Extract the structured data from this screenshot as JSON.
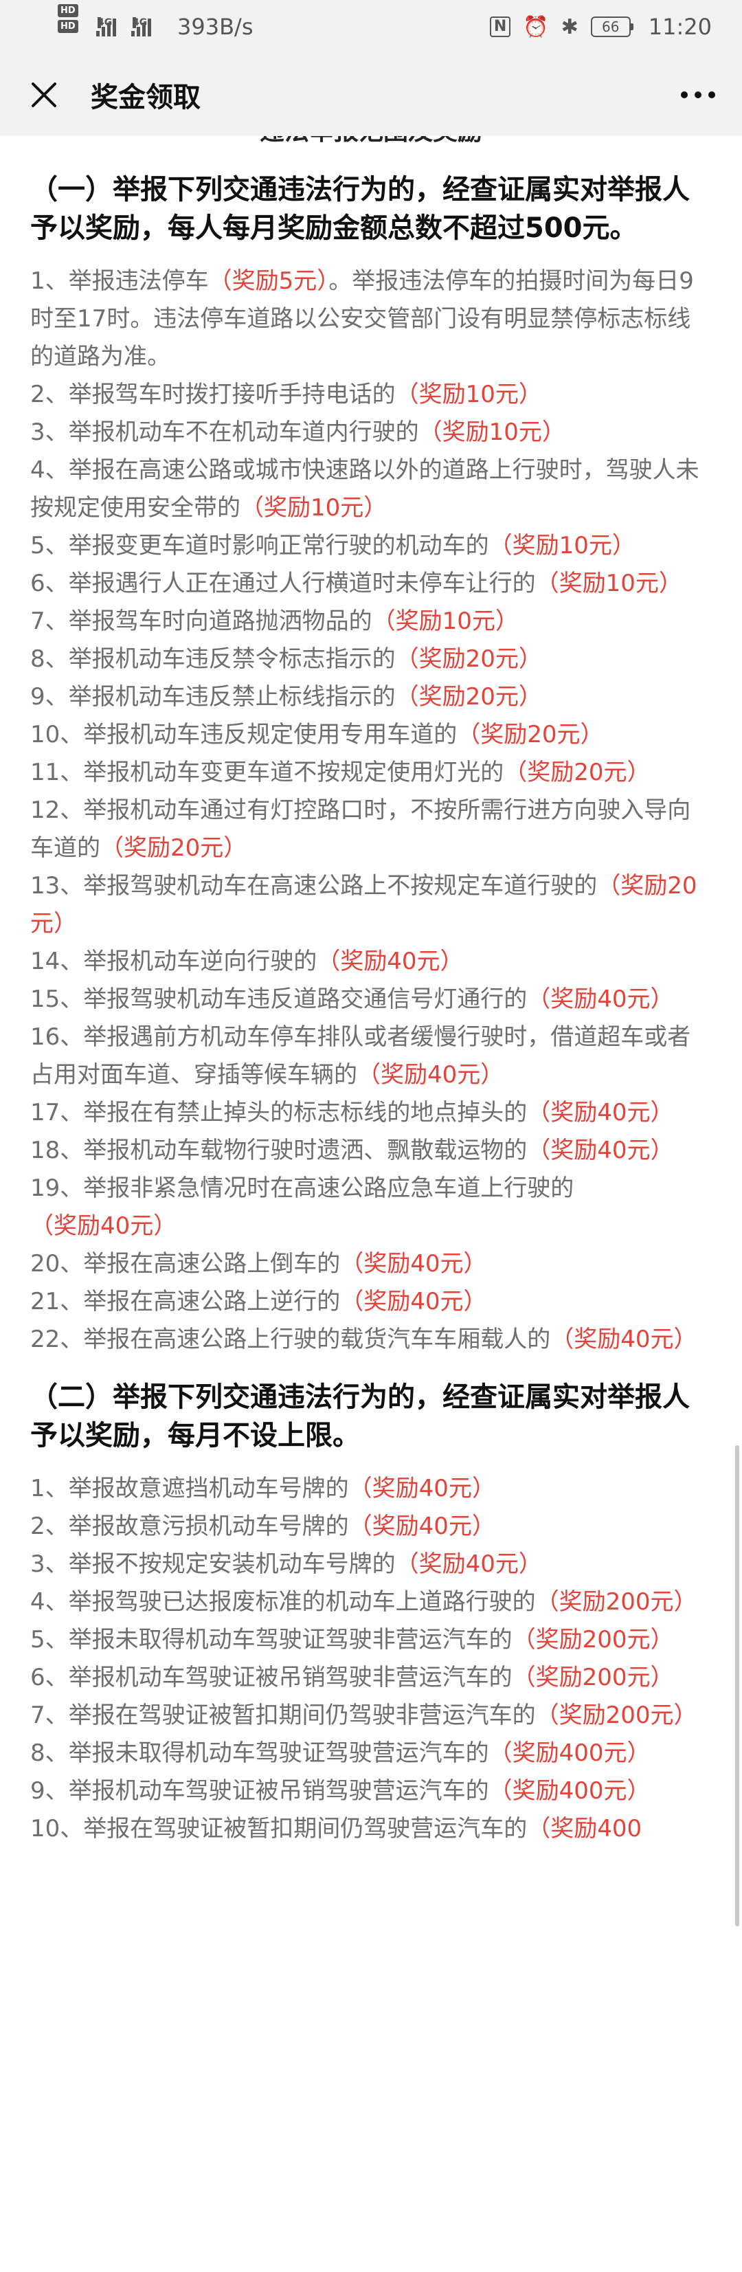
{
  "status_bar": {
    "hd1": "HD",
    "hd2": "HD",
    "sig1": "4G",
    "sig2": "4G",
    "speed": "393B/s",
    "battery": "66",
    "time": "11:20"
  },
  "nav": {
    "title": "奖金领取"
  },
  "clipped_heading": "违法举报范围及奖励",
  "section1": {
    "heading": "（一）举报下列交通违法行为的，经查证属实对举报人予以奖励，每人每月奖励金额总数不超过500元。",
    "items": [
      {
        "num": "1、",
        "text": "举报违法停车",
        "reward": "（奖励5元）",
        "after": "。举报违法停车的拍摄时间为每日9时至17时。违法停车道路以公安交管部门设有明显禁停标志标线的道路为准。"
      },
      {
        "num": "2、",
        "text": "举报驾车时拨打接听手持电话的",
        "reward": "（奖励10元）",
        "after": ""
      },
      {
        "num": "3、",
        "text": "举报机动车不在机动车道内行驶的",
        "reward": "（奖励10元）",
        "after": ""
      },
      {
        "num": "4、",
        "text": "举报在高速公路或城市快速路以外的道路上行驶时，驾驶人未按规定使用安全带的",
        "reward": "（奖励10元）",
        "after": ""
      },
      {
        "num": "5、",
        "text": "举报变更车道时影响正常行驶的机动车的",
        "reward": "（奖励10元）",
        "after": ""
      },
      {
        "num": "6、",
        "text": "举报遇行人正在通过人行横道时未停车让行的",
        "reward": "（奖励10元）",
        "after": ""
      },
      {
        "num": "7、",
        "text": "举报驾车时向道路抛洒物品的",
        "reward": "（奖励10元）",
        "after": ""
      },
      {
        "num": "8、",
        "text": "举报机动车违反禁令标志指示的",
        "reward": "（奖励20元）",
        "after": ""
      },
      {
        "num": "9、",
        "text": "举报机动车违反禁止标线指示的",
        "reward": "（奖励20元）",
        "after": ""
      },
      {
        "num": "10、",
        "text": "举报机动车违反规定使用专用车道的",
        "reward": "（奖励20元）",
        "after": ""
      },
      {
        "num": "11、",
        "text": "举报机动车变更车道不按规定使用灯光的",
        "reward": "（奖励20元）",
        "after": ""
      },
      {
        "num": "12、",
        "text": "举报机动车通过有灯控路口时，不按所需行进方向驶入导向车道的",
        "reward": "（奖励20元）",
        "after": ""
      },
      {
        "num": "13、",
        "text": "举报驾驶机动车在高速公路上不按规定车道行驶的",
        "reward": "（奖励20元）",
        "after": ""
      },
      {
        "num": "14、",
        "text": "举报机动车逆向行驶的",
        "reward": "（奖励40元）",
        "after": ""
      },
      {
        "num": "15、",
        "text": "举报驾驶机动车违反道路交通信号灯通行的",
        "reward": "（奖励40元）",
        "after": ""
      },
      {
        "num": "16、",
        "text": "举报遇前方机动车停车排队或者缓慢行驶时，借道超车或者占用对面车道、穿插等候车辆的",
        "reward": "（奖励40元）",
        "after": ""
      },
      {
        "num": "17、",
        "text": "举报在有禁止掉头的标志标线的地点掉头的",
        "reward": "（奖励40元）",
        "after": ""
      },
      {
        "num": "18、",
        "text": "举报机动车载物行驶时遗洒、飘散载运物的",
        "reward": "（奖励40元）",
        "after": ""
      },
      {
        "num": "19、",
        "text": "举报非紧急情况时在高速公路应急车道上行驶的",
        "reward": "（奖励40元）",
        "after": ""
      },
      {
        "num": "20、",
        "text": "举报在高速公路上倒车的",
        "reward": "（奖励40元）",
        "after": ""
      },
      {
        "num": "21、",
        "text": "举报在高速公路上逆行的",
        "reward": "（奖励40元）",
        "after": ""
      },
      {
        "num": "22、",
        "text": "举报在高速公路上行驶的载货汽车车厢载人的",
        "reward": "（奖励40元）",
        "after": ""
      }
    ]
  },
  "section2": {
    "heading": "（二）举报下列交通违法行为的，经查证属实对举报人予以奖励，每月不设上限。",
    "items": [
      {
        "num": "1、",
        "text": "举报故意遮挡机动车号牌的",
        "reward": "（奖励40元）",
        "after": ""
      },
      {
        "num": "2、",
        "text": "举报故意污损机动车号牌的",
        "reward": "（奖励40元）",
        "after": ""
      },
      {
        "num": "3、",
        "text": "举报不按规定安装机动车号牌的",
        "reward": "（奖励40元）",
        "after": ""
      },
      {
        "num": "4、",
        "text": "举报驾驶已达报废标准的机动车上道路行驶的",
        "reward": "（奖励200元）",
        "after": ""
      },
      {
        "num": "5、",
        "text": "举报未取得机动车驾驶证驾驶非营运汽车的",
        "reward": "（奖励200元）",
        "after": ""
      },
      {
        "num": "6、",
        "text": "举报机动车驾驶证被吊销驾驶非营运汽车的",
        "reward": "（奖励200元）",
        "after": ""
      },
      {
        "num": "7、",
        "text": "举报在驾驶证被暂扣期间仍驾驶非营运汽车的",
        "reward": "（奖励200元）",
        "after": ""
      },
      {
        "num": "8、",
        "text": "举报未取得机动车驾驶证驾驶营运汽车的",
        "reward": "（奖励400元）",
        "after": ""
      },
      {
        "num": "9、",
        "text": "举报机动车驾驶证被吊销驾驶营运汽车的",
        "reward": "（奖励400元）",
        "after": ""
      },
      {
        "num": "10、",
        "text": "举报在驾驶证被暂扣期间仍驾驶营运汽车的",
        "reward": "（奖励400",
        "after": ""
      }
    ]
  }
}
